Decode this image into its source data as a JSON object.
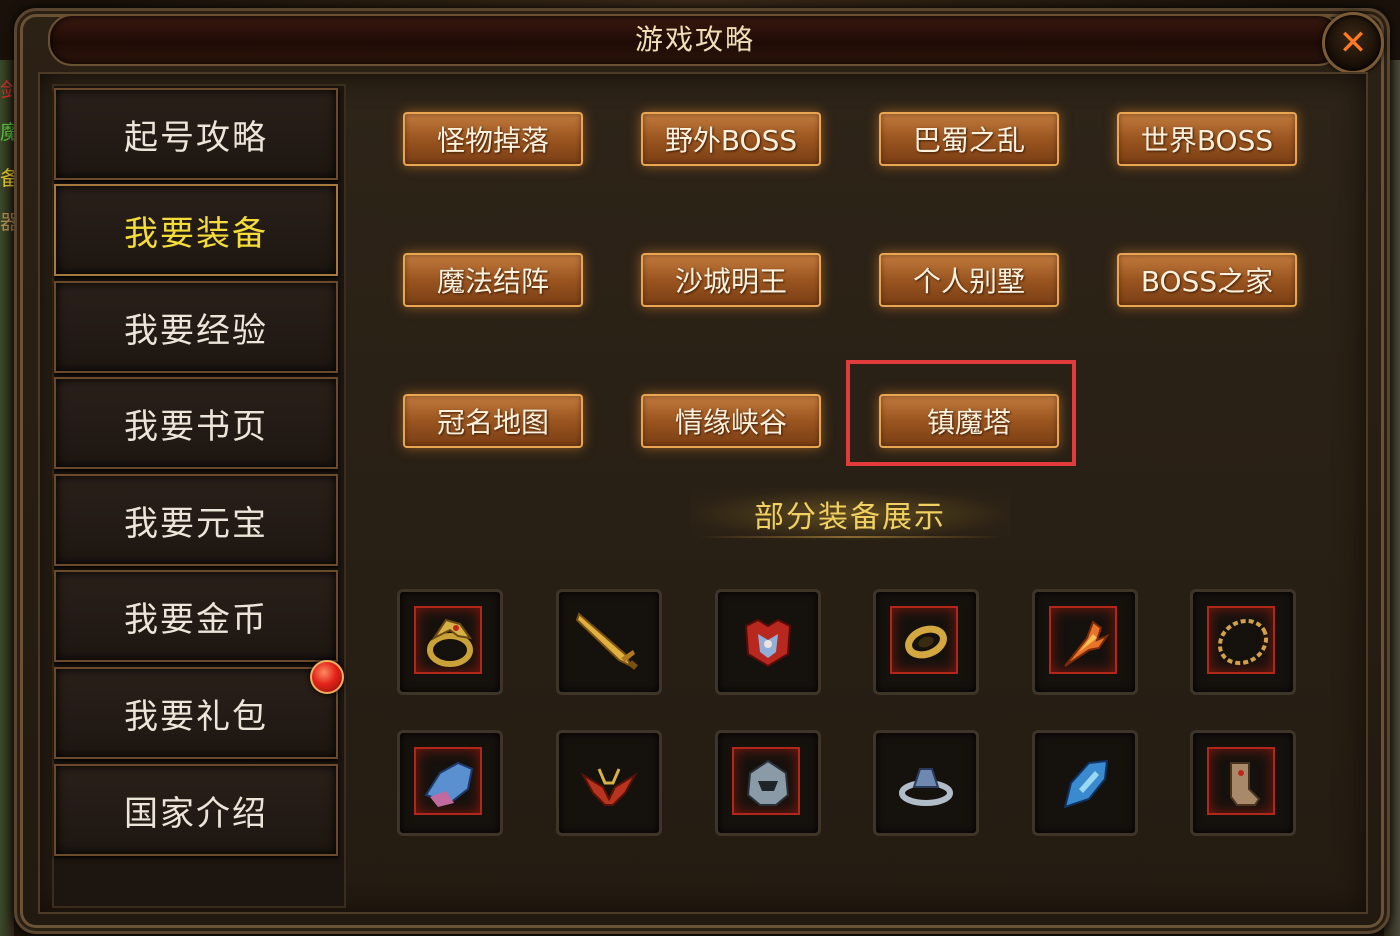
{
  "window": {
    "title": "游戏攻略"
  },
  "colors": {
    "accent_yellow": "#f4dc3a",
    "button_orange": "#b56a2e",
    "highlight_red": "#e23b3b",
    "close_orange": "#ff7a22"
  },
  "side_glyphs": [
    "剑",
    "魔",
    "备",
    "器"
  ],
  "menu": {
    "items": [
      {
        "label": "起号攻略",
        "active": false
      },
      {
        "label": "我要装备",
        "active": true
      },
      {
        "label": "我要经验",
        "active": false
      },
      {
        "label": "我要书页",
        "active": false
      },
      {
        "label": "我要元宝",
        "active": false
      },
      {
        "label": "我要金币",
        "active": false
      },
      {
        "label": "我要礼包",
        "active": false
      },
      {
        "label": "国家介绍",
        "active": false
      }
    ]
  },
  "guides": {
    "buttons": [
      "怪物掉落",
      "野外BOSS",
      "巴蜀之乱",
      "世界BOSS",
      "魔法结阵",
      "沙城明王",
      "个人别墅",
      "BOSS之家",
      "冠名地图",
      "情缘峡谷",
      "镇魔塔"
    ],
    "highlighted": "镇魔塔"
  },
  "equipment": {
    "heading": "部分装备展示",
    "items": [
      "golden-dragon-ring-icon",
      "golden-sword-icon",
      "red-armor-icon",
      "gold-ring-icon",
      "flame-feather-icon",
      "gold-chain-necklace-icon",
      "blue-bracer-icon",
      "winged-belt-icon",
      "silver-helmet-icon",
      "silver-ring-icon",
      "blue-gauntlet-icon",
      "bronze-boots-icon"
    ]
  }
}
